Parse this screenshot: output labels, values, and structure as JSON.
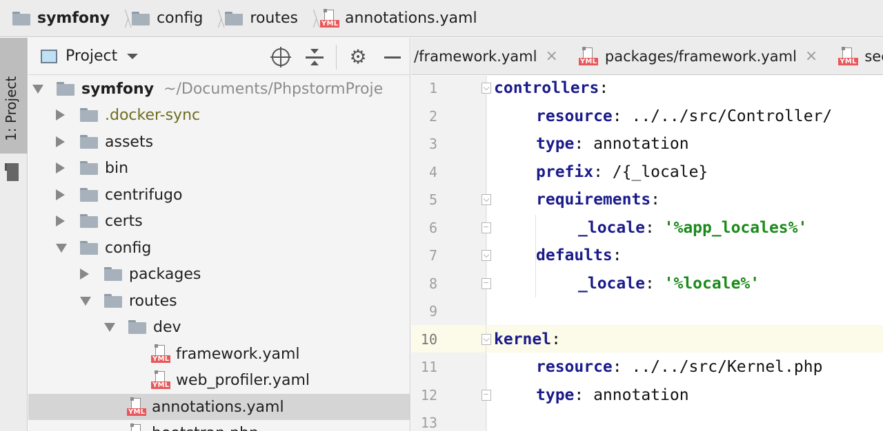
{
  "breadcrumb": {
    "items": [
      {
        "label": "symfony",
        "icon": "folder-icon",
        "bold": true
      },
      {
        "label": "config",
        "icon": "folder-icon"
      },
      {
        "label": "routes",
        "icon": "folder-icon"
      },
      {
        "label": "annotations.yaml",
        "icon": "yml-file-icon"
      }
    ],
    "file_badge": "YML"
  },
  "tool_window_strip": {
    "label": "1: Project"
  },
  "project_panel": {
    "title": "Project",
    "tree": [
      {
        "label": "symfony",
        "suffix": "~/Documents/PhpstormProje",
        "type": "folder",
        "expanded": true,
        "depth": 0
      },
      {
        "label": ".docker-sync",
        "type": "folder",
        "expanded": false,
        "depth": 1
      },
      {
        "label": "assets",
        "type": "folder",
        "expanded": false,
        "depth": 1
      },
      {
        "label": "bin",
        "type": "folder",
        "expanded": false,
        "depth": 1
      },
      {
        "label": "centrifugo",
        "type": "folder",
        "expanded": false,
        "depth": 1
      },
      {
        "label": "certs",
        "type": "folder",
        "expanded": false,
        "depth": 1
      },
      {
        "label": "config",
        "type": "folder",
        "expanded": true,
        "depth": 1
      },
      {
        "label": "packages",
        "type": "folder",
        "expanded": false,
        "depth": 2
      },
      {
        "label": "routes",
        "type": "folder",
        "expanded": true,
        "depth": 2
      },
      {
        "label": "dev",
        "type": "folder",
        "expanded": true,
        "depth": 3
      },
      {
        "label": "framework.yaml",
        "type": "yml",
        "depth": 4
      },
      {
        "label": "web_profiler.yaml",
        "type": "yml",
        "depth": 4
      },
      {
        "label": "annotations.yaml",
        "type": "yml",
        "depth": 3,
        "selected": true
      },
      {
        "label": "bootstrap.php",
        "type": "php",
        "depth": 3
      }
    ]
  },
  "editor_tabs": [
    {
      "label": "/framework.yaml",
      "closable": true
    },
    {
      "label": "packages/framework.yaml",
      "closable": true
    },
    {
      "label": "secu",
      "closable": false
    }
  ],
  "tab_close_glyph": "×",
  "editor": {
    "current_line": 10,
    "lines": [
      {
        "n": "1",
        "tokens": [
          {
            "t": "controllers",
            "c": "key"
          },
          {
            "t": ":",
            "c": "plain"
          }
        ],
        "indent": 0
      },
      {
        "n": "2",
        "tokens": [
          {
            "t": "resource",
            "c": "key"
          },
          {
            "t": ": ../../src/Controller/",
            "c": "plain"
          }
        ],
        "indent": 1
      },
      {
        "n": "3",
        "tokens": [
          {
            "t": "type",
            "c": "key"
          },
          {
            "t": ": annotation",
            "c": "plain"
          }
        ],
        "indent": 1
      },
      {
        "n": "4",
        "tokens": [
          {
            "t": "prefix",
            "c": "key"
          },
          {
            "t": ": /{_locale}",
            "c": "plain"
          }
        ],
        "indent": 1
      },
      {
        "n": "5",
        "tokens": [
          {
            "t": "requirements",
            "c": "key"
          },
          {
            "t": ":",
            "c": "plain"
          }
        ],
        "indent": 1
      },
      {
        "n": "6",
        "tokens": [
          {
            "t": "_locale",
            "c": "key"
          },
          {
            "t": ": ",
            "c": "plain"
          },
          {
            "t": "'%app_locales%'",
            "c": "str"
          }
        ],
        "indent": 2
      },
      {
        "n": "7",
        "tokens": [
          {
            "t": "defaults",
            "c": "key"
          },
          {
            "t": ":",
            "c": "plain"
          }
        ],
        "indent": 1
      },
      {
        "n": "8",
        "tokens": [
          {
            "t": "_locale",
            "c": "key"
          },
          {
            "t": ": ",
            "c": "plain"
          },
          {
            "t": "'%locale%'",
            "c": "str"
          }
        ],
        "indent": 2
      },
      {
        "n": "9",
        "tokens": [],
        "indent": 0
      },
      {
        "n": "10",
        "tokens": [
          {
            "t": "kernel",
            "c": "key"
          },
          {
            "t": ":",
            "c": "plain"
          }
        ],
        "indent": 0
      },
      {
        "n": "11",
        "tokens": [
          {
            "t": "resource",
            "c": "key"
          },
          {
            "t": ": ../../src/Kernel.php",
            "c": "plain"
          }
        ],
        "indent": 1
      },
      {
        "n": "12",
        "tokens": [
          {
            "t": "type",
            "c": "key"
          },
          {
            "t": ": annotation",
            "c": "plain"
          }
        ],
        "indent": 1
      },
      {
        "n": "13",
        "tokens": [],
        "indent": 0
      }
    ]
  },
  "colors": {
    "key": "#1a1a8a",
    "string": "#1a8a1a",
    "yml_badge": "#e8575a",
    "current_line": "#fcfae8"
  }
}
